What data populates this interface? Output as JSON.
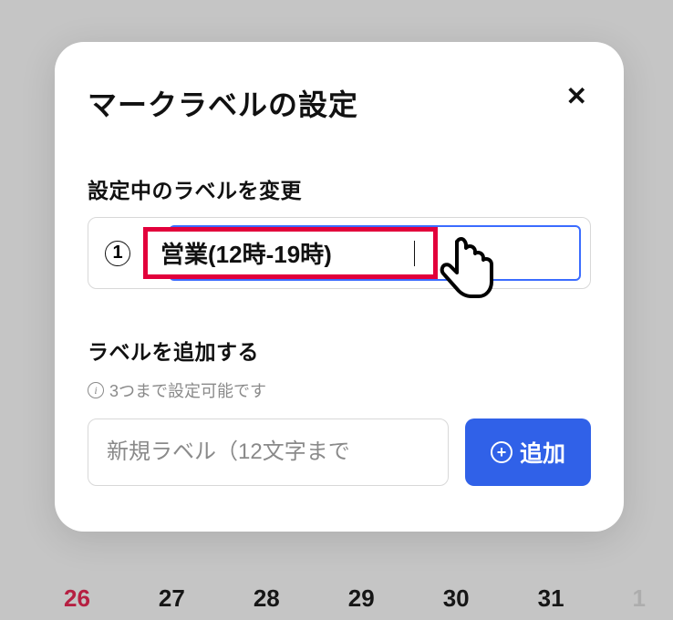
{
  "modal": {
    "title": "マークラベルの設定",
    "close_glyph": "✕"
  },
  "edit": {
    "section_label": "設定中のラベルを変更",
    "item_number": "1",
    "value": "営業(12時-19時)"
  },
  "add": {
    "section_label": "ラベルを追加する",
    "hint_text": "3つまで設定可能です",
    "placeholder": "新規ラベル（12文字まで",
    "button_label": "追加",
    "plus_glyph": "+"
  },
  "background": {
    "dates": [
      "26",
      "27",
      "28",
      "29",
      "30",
      "31",
      "1"
    ]
  }
}
